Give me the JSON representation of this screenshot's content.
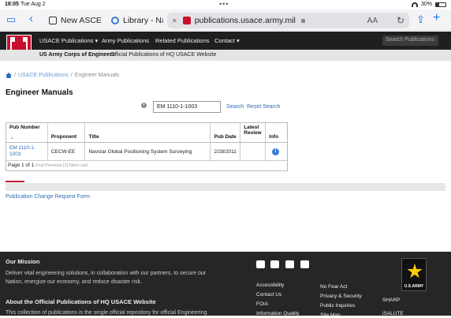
{
  "status_bar": {
    "time": "18:05",
    "date": "Tue Aug 2",
    "battery": "30%",
    "battery_level": 0.3
  },
  "browser": {
    "tabs": [
      {
        "label": "New ASCE M",
        "icon": "asce-icon"
      },
      {
        "label": "Library - Nati",
        "icon": "library-icon"
      },
      {
        "label": "publications.usace.army.mil",
        "icon": "usace-icon",
        "active": true
      }
    ],
    "reader_label": "AA"
  },
  "site": {
    "nav": [
      "USACE Publications",
      "Army Publications",
      "Related Publications",
      "Contact"
    ],
    "nav_dropdown_suffix": "▾",
    "search_placeholder": "Search Publications",
    "org_name": "US Army Corps of Engineers",
    "org_subtitle": "Official Publications of HQ USACE Website"
  },
  "breadcrumb": {
    "parent": "USACE Publications",
    "separator": "/",
    "current": "Engineer Manuals"
  },
  "page": {
    "title": "Engineer Manuals",
    "search_value": "EM 1110-1-1003",
    "search_label": "Search",
    "reset_label": "Reset Search",
    "change_request_link": "Publication Change Request Form"
  },
  "table": {
    "headers": {
      "pub_number": "Pub Number",
      "proponent": "Proponent",
      "title": "Title",
      "pub_date": "Pub Date",
      "latest_review": "Latest Review",
      "info": "Info"
    },
    "rows": [
      {
        "pub_number": "EM 1110-1-1003",
        "proponent": "CECW-EE",
        "title": "Navstar Global Positioning System Surveying",
        "pub_date": "2/28/2011",
        "latest_review": ""
      }
    ],
    "pager": {
      "text": "Page 1 of 1",
      "nav": "First Previous [1] Next Last"
    }
  },
  "footer": {
    "mission_heading": "Our Mission",
    "mission_text": "Deliver vital engineering solutions, in collaboration with our partners, to secure our Nation, energize our economy, and reduce disaster risk.",
    "about_heading": "About the Official Publications of HQ USACE Website",
    "about_text": "This collection of publications is the single official repository for official Engineering",
    "links_col1": [
      "Accessibility",
      "Contact Us",
      "FOIA",
      "Information Quality"
    ],
    "links_col2": [
      "No Fear Act",
      "Privacy & Security",
      "Public Inquiries",
      "Site Map"
    ],
    "links_col3": [
      "SHARP",
      "iSALUTE"
    ],
    "army_logo_label": "U.S.ARMY",
    "social_icons": [
      "facebook-icon",
      "twitter-icon",
      "youtube-icon",
      "flickr-icon"
    ]
  }
}
